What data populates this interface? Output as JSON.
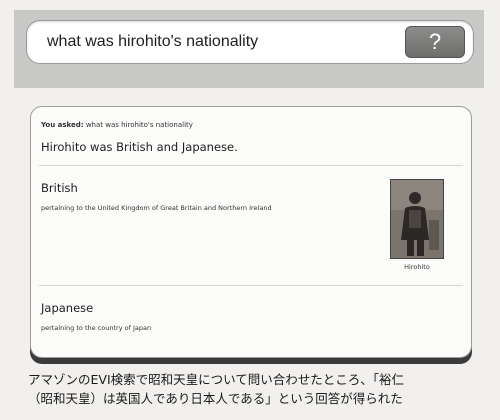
{
  "search": {
    "query": "what was hirohito's nationality",
    "button_label": "?"
  },
  "answer": {
    "asked_label": "You asked:",
    "asked_query": "what was hirohito's nationality",
    "title": "Hirohito was British and Japanese.",
    "items": [
      {
        "term": "British",
        "description": "pertaining to the United Kingdom of Great Britain and Northern Ireland"
      },
      {
        "term": "Japanese",
        "description": "pertaining to the country of Japan"
      }
    ],
    "photo_caption": "Hirohito"
  },
  "caption": {
    "line1": "アマゾンのEVI検索で昭和天皇について問い合わせたところ、「裕仁",
    "line2": "（昭和天皇）は英国人であり日本人である」という回答が得られた"
  }
}
